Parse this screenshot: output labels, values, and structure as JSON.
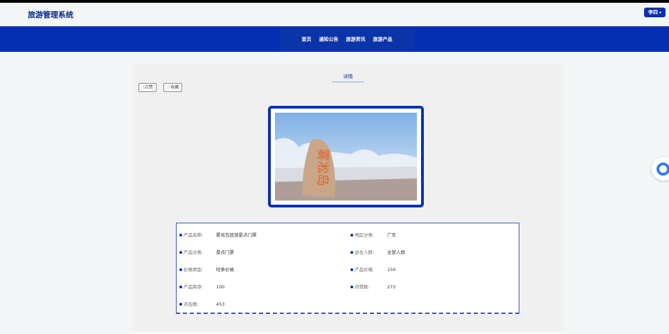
{
  "header": {
    "brand": "旅游管理系统",
    "user_label": "李四",
    "user_caret": "▾"
  },
  "nav": {
    "items": [
      "首页",
      "通知公告",
      "旅游资讯",
      "旅游产品"
    ]
  },
  "detail": {
    "title": "详情",
    "like_label": "点赞",
    "favorite_label": "收藏",
    "image_text": "雾凇岛",
    "fields": [
      {
        "label": "产品名称:",
        "value": "雾凇岛旅游景点门票"
      },
      {
        "label": "地区分类:",
        "value": "广东"
      },
      {
        "label": "产品分类:",
        "value": "景点门票"
      },
      {
        "label": "适合人群:",
        "value": "全部人群"
      },
      {
        "label": "价格类型:",
        "value": "旺季价格"
      },
      {
        "label": "产品价格:",
        "value": "150"
      },
      {
        "label": "产品库存:",
        "value": "100"
      },
      {
        "label": "点赞数:",
        "value": "272"
      },
      {
        "label": "点击数:",
        "value": "453"
      }
    ]
  },
  "colors": {
    "primary": "#0630b4",
    "brand_text": "#0b2a8a",
    "float_accent": "#2f7df6"
  },
  "icons": {
    "like": "thumb-up-icon",
    "favorite": "heart-icon",
    "float": "chat-icon"
  }
}
